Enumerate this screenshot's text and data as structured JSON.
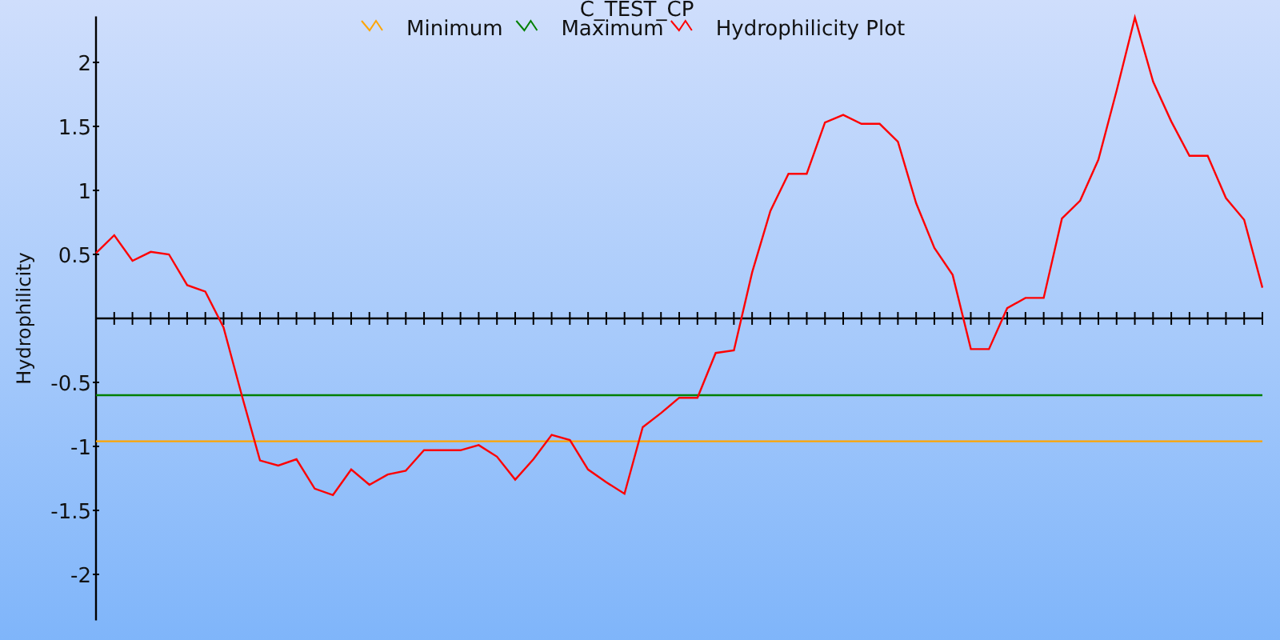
{
  "chart": {
    "chart_data": {
      "type": "line",
      "title": "C_TEST_CP",
      "ylabel": "Hydrophilicity",
      "legend": "top",
      "ylim": [
        -2.36,
        2.36
      ],
      "yticks": [
        -2,
        -1.5,
        -1,
        -0.5,
        0.5,
        1,
        1.5,
        2
      ],
      "series": [
        {
          "name": "Minimum",
          "color": "#ffa500",
          "values": [
            -0.96,
            -0.96,
            -0.96,
            -0.96,
            -0.96,
            -0.96,
            -0.96,
            -0.96,
            -0.96,
            -0.96,
            -0.96,
            -0.96,
            -0.96,
            -0.96,
            -0.96,
            -0.96,
            -0.96,
            -0.96,
            -0.96,
            -0.96,
            -0.96,
            -0.96,
            -0.96,
            -0.96,
            -0.96,
            -0.96,
            -0.96,
            -0.96,
            -0.96,
            -0.96,
            -0.96,
            -0.96,
            -0.96,
            -0.96,
            -0.96,
            -0.96,
            -0.96,
            -0.96,
            -0.96,
            -0.96,
            -0.96,
            -0.96,
            -0.96,
            -0.96,
            -0.96,
            -0.96,
            -0.96,
            -0.96,
            -0.96,
            -0.96,
            -0.96,
            -0.96,
            -0.96,
            -0.96,
            -0.96,
            -0.96,
            -0.96,
            -0.96,
            -0.96,
            -0.96,
            -0.96,
            -0.96,
            -0.96,
            -0.96,
            -0.96
          ]
        },
        {
          "name": "Maximum",
          "color": "#008000",
          "values": [
            -0.6,
            -0.6,
            -0.6,
            -0.6,
            -0.6,
            -0.6,
            -0.6,
            -0.6,
            -0.6,
            -0.6,
            -0.6,
            -0.6,
            -0.6,
            -0.6,
            -0.6,
            -0.6,
            -0.6,
            -0.6,
            -0.6,
            -0.6,
            -0.6,
            -0.6,
            -0.6,
            -0.6,
            -0.6,
            -0.6,
            -0.6,
            -0.6,
            -0.6,
            -0.6,
            -0.6,
            -0.6,
            -0.6,
            -0.6,
            -0.6,
            -0.6,
            -0.6,
            -0.6,
            -0.6,
            -0.6,
            -0.6,
            -0.6,
            -0.6,
            -0.6,
            -0.6,
            -0.6,
            -0.6,
            -0.6,
            -0.6,
            -0.6,
            -0.6,
            -0.6,
            -0.6,
            -0.6,
            -0.6,
            -0.6,
            -0.6,
            -0.6,
            -0.6,
            -0.6,
            -0.6,
            -0.6,
            -0.6,
            -0.6,
            -0.6
          ]
        },
        {
          "name": "Hydrophilicity Plot",
          "color": "#ff0000",
          "values": [
            0.51,
            0.65,
            0.45,
            0.52,
            0.5,
            0.26,
            0.21,
            -0.07,
            -0.6,
            -1.11,
            -1.15,
            -1.1,
            -1.33,
            -1.38,
            -1.18,
            -1.3,
            -1.22,
            -1.19,
            -1.03,
            -1.03,
            -1.03,
            -0.99,
            -1.08,
            -1.26,
            -1.1,
            -0.91,
            -0.95,
            -1.18,
            -1.28,
            -1.37,
            -0.85,
            -0.74,
            -0.62,
            -0.62,
            -0.27,
            -0.25,
            0.36,
            0.84,
            1.13,
            1.13,
            1.53,
            1.59,
            1.52,
            1.52,
            1.38,
            0.9,
            0.55,
            0.34,
            -0.24,
            -0.24,
            0.08,
            0.16,
            0.16,
            0.78,
            0.92,
            1.24,
            1.78,
            2.35,
            1.85,
            1.54,
            1.27,
            1.27,
            0.94,
            0.77,
            0.24
          ]
        }
      ]
    }
  }
}
